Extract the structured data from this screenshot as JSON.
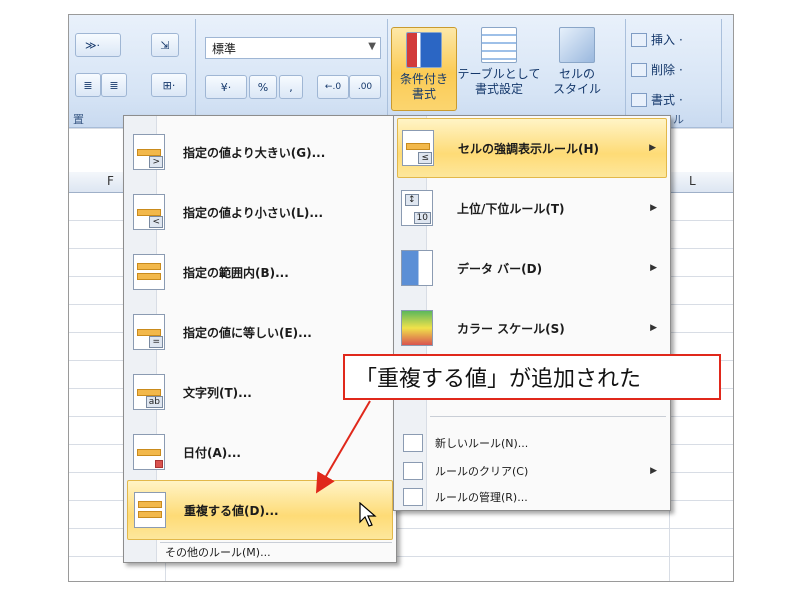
{
  "ribbon": {
    "number_format_value": "標準",
    "percent_symbol": "%",
    "comma_symbol": ",",
    "decimal_inc": "+.0\n.00",
    "decimal_dec": ".00\n→.0",
    "conditional_format_label": "条件付き\n書式",
    "format_as_table_label": "テーブルとして\n書式設定",
    "cell_styles_label": "セルの\nスタイル",
    "insert_label": "挿入",
    "delete_label": "削除",
    "format_label": "書式",
    "group_label_left": "置",
    "group_label_right": "ル"
  },
  "sheet": {
    "column_headers": [
      "F",
      "L"
    ]
  },
  "left_menu": {
    "items": [
      {
        "label": "指定の値より大きい(G)...",
        "symbol": ">"
      },
      {
        "label": "指定の値より小さい(L)...",
        "symbol": "<"
      },
      {
        "label": "指定の範囲内(B)...",
        "symbol": ""
      },
      {
        "label": "指定の値に等しい(E)...",
        "symbol": "="
      },
      {
        "label": "文字列(T)...",
        "symbol": "ab"
      },
      {
        "label": "日付(A)...",
        "symbol": ""
      },
      {
        "label": "重複する値(D)...",
        "symbol": ""
      }
    ],
    "other_rules": "その他のルール(M)..."
  },
  "right_menu": {
    "items": [
      {
        "label": "セルの強調表示ルール(H)",
        "arrow": "▶"
      },
      {
        "label": "上位/下位ルール(T)",
        "arrow": "▶"
      },
      {
        "label": "データ バー(D)",
        "arrow": "▶"
      },
      {
        "label": "カラー スケール(S)",
        "arrow": "▶"
      }
    ],
    "small_items": [
      {
        "label": "新しいルール(N)...",
        "arrow": ""
      },
      {
        "label": "ルールのクリア(C)",
        "arrow": "▶"
      },
      {
        "label": "ルールの管理(R)...",
        "arrow": ""
      }
    ]
  },
  "annotation": {
    "text": "「重複する値」が追加された",
    "color": "#e0281b"
  },
  "colors": {
    "highlight": "#fedb76",
    "ribbon_bg": "#d6e4f5"
  }
}
